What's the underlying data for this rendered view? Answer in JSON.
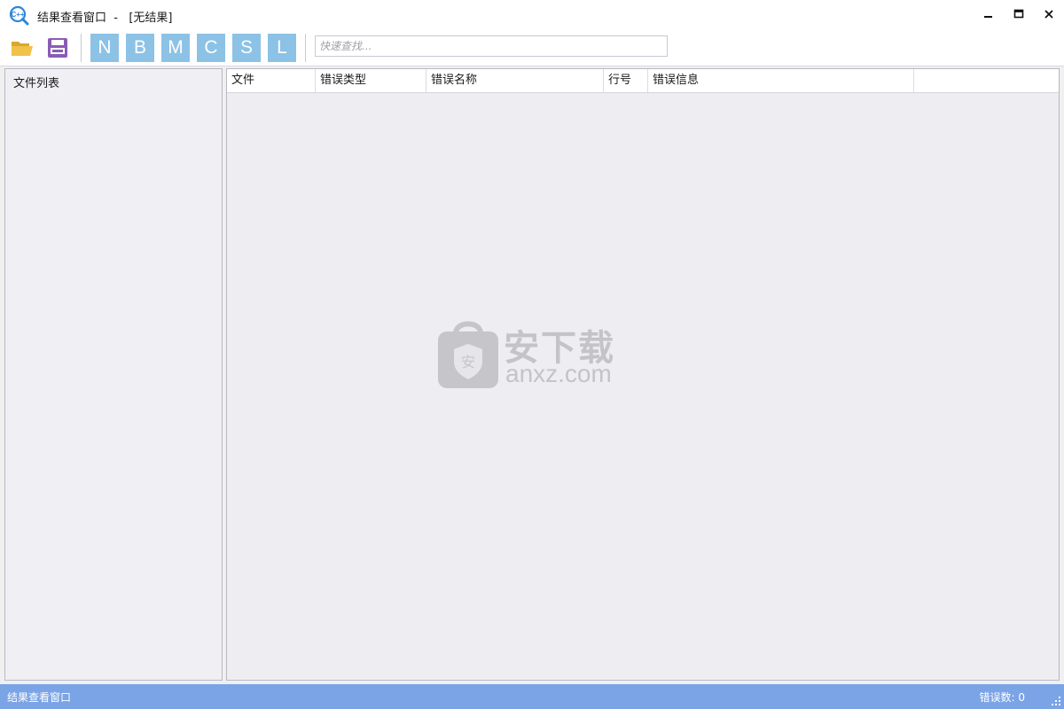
{
  "window": {
    "title": "结果查看窗口  -   [无结果]"
  },
  "toolbar": {
    "buttons": [
      {
        "icon": "open-folder-icon",
        "color": "#f0c24a"
      },
      {
        "icon": "save-icon",
        "color": "#8a5cb5"
      }
    ],
    "filters": [
      "N",
      "B",
      "M",
      "C",
      "S",
      "L"
    ],
    "filter_color": "#8cc2e6",
    "search": {
      "value": "",
      "placeholder": "快速查找..."
    }
  },
  "file_list": {
    "title": "文件列表"
  },
  "results_table": {
    "columns": [
      "文件",
      "错误类型",
      "错误名称",
      "行号",
      "错误信息",
      ""
    ],
    "rows": []
  },
  "watermark": {
    "brand": "安下载",
    "domain": "anxz.com",
    "shield_char": "安"
  },
  "statusbar": {
    "left_text": "结果查看窗口",
    "error_count_text": "错误数: 0",
    "color": "#7ba4e6"
  }
}
